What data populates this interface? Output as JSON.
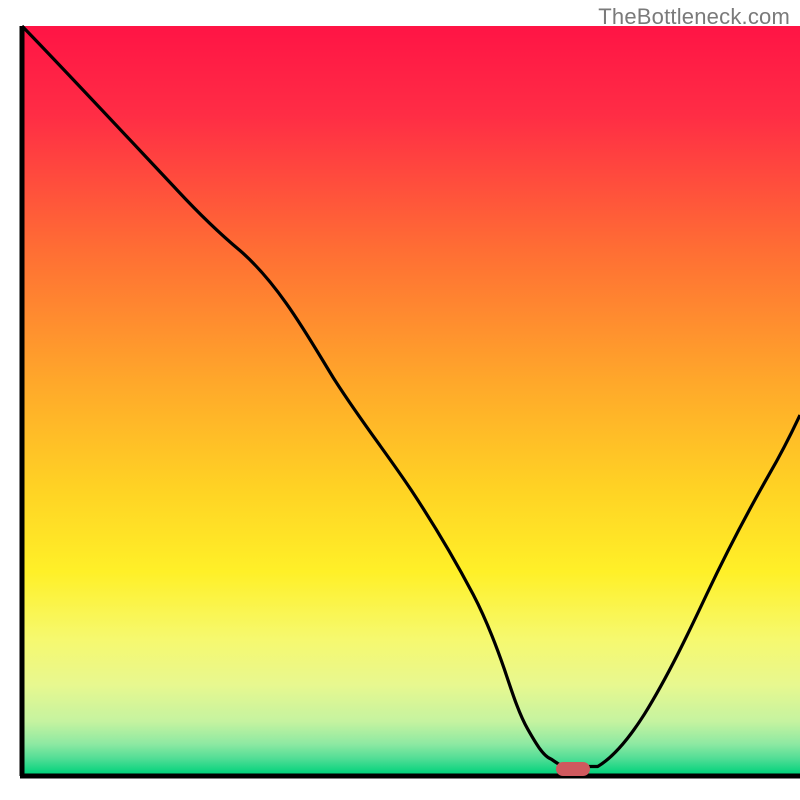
{
  "watermark": "TheBottleneck.com",
  "chart_data": {
    "type": "line",
    "title": "",
    "xlabel": "",
    "ylabel": "",
    "xlim": [
      0,
      100
    ],
    "ylim": [
      0,
      100
    ],
    "grid": false,
    "legend": false,
    "background_gradient": [
      "#ff1647",
      "#ff8d2a",
      "#ffe324",
      "#f7f97a",
      "#9eeca0",
      "#00d27a"
    ],
    "series": [
      {
        "name": "bottleneck-curve",
        "x": [
          0,
          10,
          20,
          28,
          40,
          50,
          58,
          62,
          65,
          68,
          70,
          74,
          80,
          88,
          96,
          100
        ],
        "y": [
          100,
          89,
          78,
          70,
          53,
          38,
          24,
          14,
          6,
          2,
          1,
          1,
          8,
          24,
          40,
          48
        ]
      }
    ],
    "marker": {
      "shape": "pill",
      "color": "#d05a5f",
      "x": 68,
      "y": 0,
      "width": 4,
      "height": 1.5
    },
    "axes": {
      "left": {
        "x": 2.5,
        "y0": 3,
        "y1": 97
      },
      "bottom": {
        "y": 97,
        "x0": 2.5,
        "x1": 100
      }
    }
  }
}
